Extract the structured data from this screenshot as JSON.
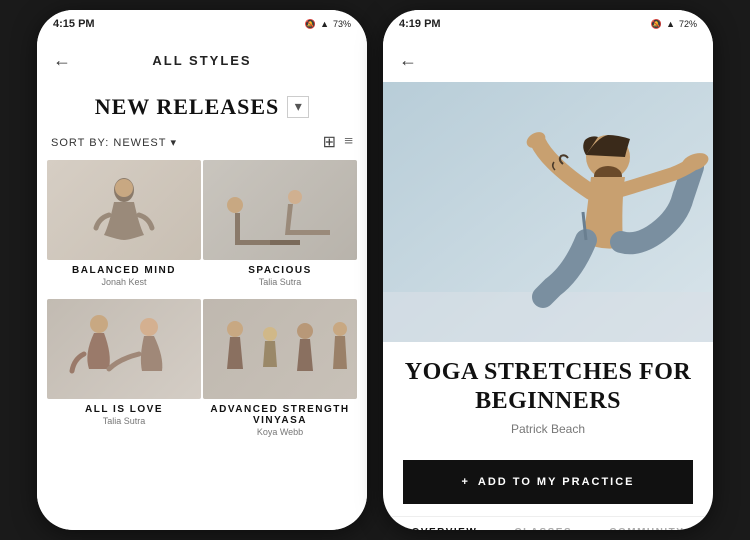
{
  "left_phone": {
    "status": {
      "time": "4:15 PM",
      "battery": "73%",
      "signal": "4G"
    },
    "nav": {
      "back_label": "←",
      "title": "ALL STYLES"
    },
    "section": {
      "title": "NEW RELEASES",
      "dropdown_symbol": "▾"
    },
    "sort": {
      "label": "SORT BY:",
      "value": "NEWEST",
      "caret": "▾"
    },
    "videos": [
      {
        "title": "BALANCED MIND",
        "subtitle": "Jonah Kest",
        "thumb": "thumb-1"
      },
      {
        "title": "SPACIOUS",
        "subtitle": "Talia Sutra",
        "thumb": "thumb-2"
      },
      {
        "title": "ALL IS LOVE",
        "subtitle": "Talia Sutra",
        "thumb": "thumb-3"
      },
      {
        "title": "ADVANCED STRENGTH VINYASA",
        "subtitle": "Koya Webb",
        "thumb": "thumb-4"
      },
      {
        "title": "",
        "subtitle": "",
        "thumb": "thumb-5"
      },
      {
        "title": "",
        "subtitle": "",
        "thumb": "thumb-6"
      }
    ]
  },
  "right_phone": {
    "status": {
      "time": "4:19 PM",
      "battery": "72%",
      "signal": "4G"
    },
    "nav": {
      "back_label": "←"
    },
    "hero_title": "YOGA STRETCHES FOR BEGINNERS",
    "hero_author": "Patrick Beach",
    "add_btn_icon": "+",
    "add_btn_label": "ADD TO MY PRACTICE",
    "tabs": [
      {
        "label": "OVERVIEW",
        "active": true
      },
      {
        "label": "CLASSES",
        "active": false
      },
      {
        "label": "COMMUNITY",
        "active": false
      }
    ]
  },
  "icons": {
    "grid": "⊞",
    "list": "≡",
    "back": "←"
  }
}
